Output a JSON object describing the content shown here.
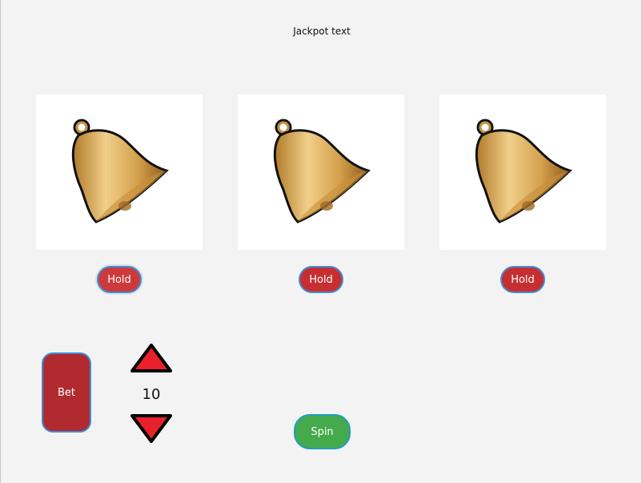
{
  "header": {
    "jackpot_text": "Jackpot text"
  },
  "reels": [
    {
      "symbol": "bell-icon",
      "hold_label": "Hold"
    },
    {
      "symbol": "bell-icon",
      "hold_label": "Hold"
    },
    {
      "symbol": "bell-icon",
      "hold_label": "Hold"
    }
  ],
  "controls": {
    "bet_label": "Bet",
    "bet_value": "10",
    "spin_label": "Spin",
    "increase_icon": "triangle-up-icon",
    "decrease_icon": "triangle-down-icon"
  },
  "colors": {
    "hold_button": "#c62f31",
    "bet_button": "#b02a2f",
    "spin_button": "#44aa4b",
    "arrow_fill": "#e8202a",
    "button_border": "#3f8ed6"
  }
}
